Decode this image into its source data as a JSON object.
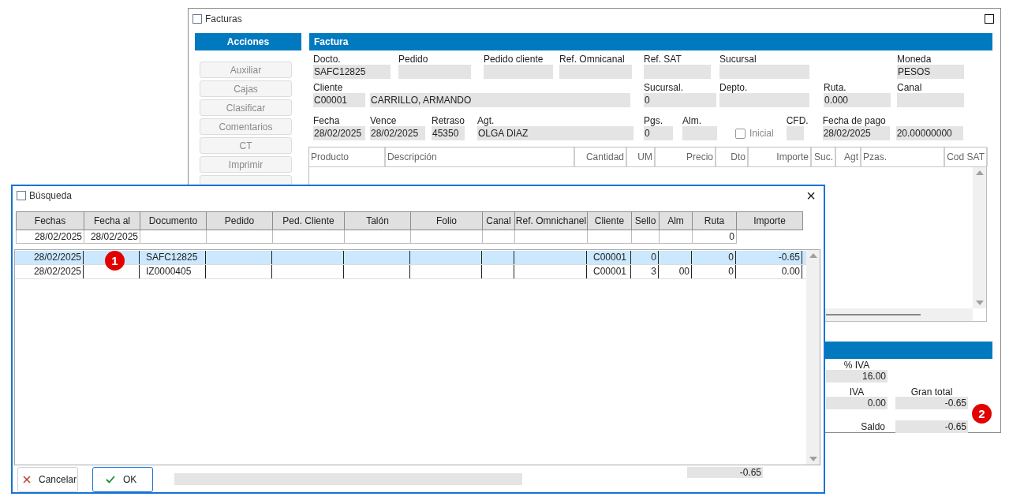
{
  "facturas_window": {
    "title": "Facturas",
    "actions": {
      "title": "Acciones",
      "buttons": [
        "Auxiliar",
        "Cajas",
        "Clasificar",
        "Comentarios",
        "CT",
        "Imprimir"
      ]
    },
    "factura": {
      "title": "Factura",
      "fields": [
        {
          "label": "Docto.",
          "value": "SAFC12825"
        },
        {
          "label": "Pedido"
        },
        {
          "label": "Pedido cliente"
        },
        {
          "label": "Ref. Omnicanal"
        },
        {
          "label": "Ref. SAT"
        },
        {
          "label": "Sucursal"
        },
        {
          "label": "Moneda",
          "value": "PESOS"
        },
        {
          "label": "Cliente",
          "value": "C00001"
        },
        {
          "value": "CARRILLO, ARMANDO"
        },
        {
          "label": "Sucursal.",
          "value": "0"
        },
        {
          "label": "Depto."
        },
        {
          "label": "Ruta.",
          "value": "0.000"
        },
        {
          "label": "Canal"
        },
        {
          "label": "Fecha",
          "value": "28/02/2025"
        },
        {
          "label": "Vence",
          "value": "28/02/2025"
        },
        {
          "label": "Retraso",
          "value": "45350"
        },
        {
          "label": "Agt.",
          "value": "OLGA DIAZ"
        },
        {
          "label": "Pgs.",
          "value": "0"
        },
        {
          "label": "Alm."
        },
        {
          "kind": "checkbox",
          "label": "Inicial",
          "checked": false
        },
        {
          "label": "CFD."
        },
        {
          "label": "Fecha de pago",
          "value": "28/02/2025"
        },
        {
          "value": "20.00000000"
        }
      ],
      "table": {
        "columns": [
          "Producto",
          "Descripción",
          "Cantidad",
          "UM",
          "Precio",
          "Dto",
          "Importe",
          "Suc.",
          "Agt",
          "Pzas.",
          "Cod SAT"
        ]
      }
    },
    "totals": [
      {
        "label": "% IVA",
        "value": "16.00"
      },
      {
        "label": "IVA",
        "value": "0.00"
      },
      {
        "label": "Gran total",
        "value": "-0.65"
      },
      {
        "label": "Saldo",
        "value": "-0.65"
      }
    ]
  },
  "busqueda_window": {
    "title": "Búsqueda",
    "close": "×",
    "columns": [
      "Fechas",
      "Fecha al",
      "Documento",
      "Pedido",
      "Ped. Cliente",
      "Talón",
      "Folio",
      "Canal",
      "Ref. Omnichanel",
      "Cliente",
      "Sello",
      "Alm",
      "Ruta",
      "Importe"
    ],
    "filter": {
      "fechas": "28/02/2025",
      "fecha_al": "28/02/2025",
      "ruta": "0"
    },
    "rows": [
      {
        "selected": true,
        "fechas": "28/02/2025",
        "documento": "SAFC12825",
        "cliente": "C00001",
        "sello": "0",
        "ruta": "0",
        "importe": "-0.65"
      },
      {
        "selected": false,
        "fechas": "28/02/2025",
        "documento": "IZ0000405",
        "cliente": "C00001",
        "sello": "3",
        "alm": "00",
        "ruta": "0",
        "importe": "0.00"
      }
    ],
    "buttons": [
      "Cancelar",
      "OK"
    ],
    "total": "-0.65"
  },
  "markers": [
    "1",
    "2"
  ]
}
